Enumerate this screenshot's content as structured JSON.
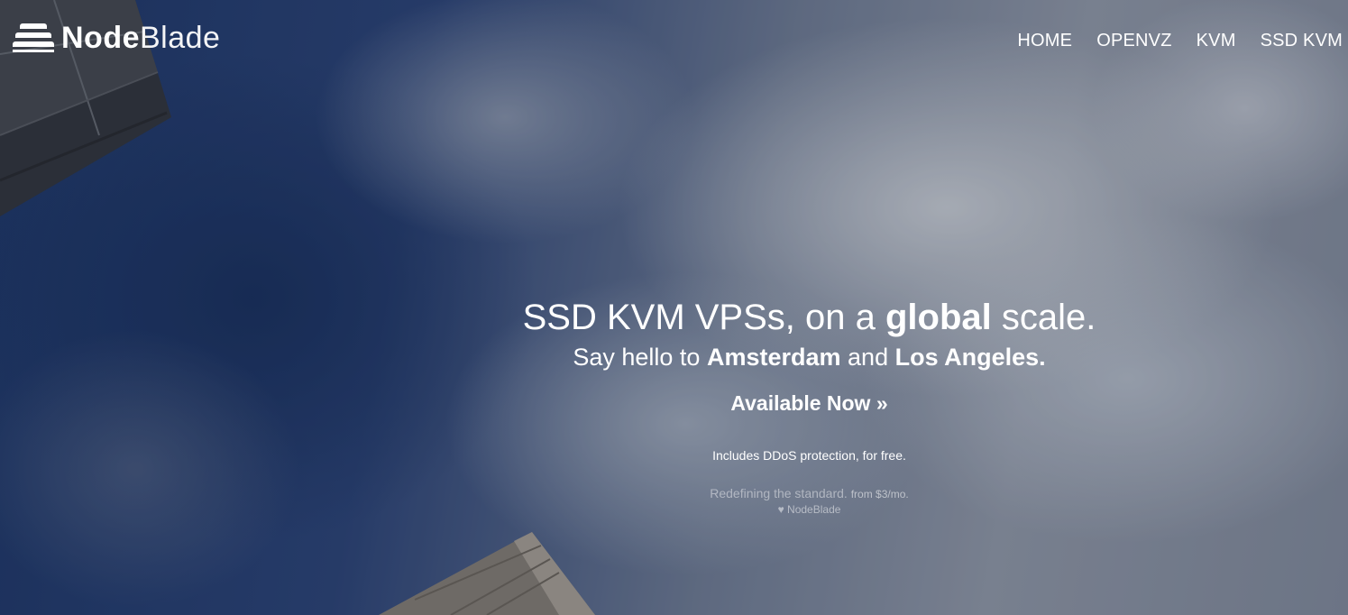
{
  "brand": {
    "name_bold": "Node",
    "name_light": "Blade"
  },
  "nav": {
    "items": [
      "HOME",
      "OPENVZ",
      "KVM",
      "SSD KVM"
    ]
  },
  "hero": {
    "headline_pre": "SSD KVM VPSs, on a",
    "headline_bold": "global",
    "headline_post": "scale.",
    "sub_pre": "Say hello to",
    "sub_city1": "Amsterdam",
    "sub_and": "and",
    "sub_city2": "Los Angeles.",
    "cta": "Available Now »",
    "ddos": "Includes DDoS protection, for free.",
    "tagline": "Redefining the standard.",
    "tagline_price": "from $3/mo.",
    "credit": "NodeBlade"
  },
  "colors": {
    "text": "#ffffff",
    "sky_dark": "#1c3566",
    "cloud": "#c8cdd4"
  },
  "icons": {
    "logo": "stacked-blades-icon",
    "credit": "heart-icon"
  }
}
